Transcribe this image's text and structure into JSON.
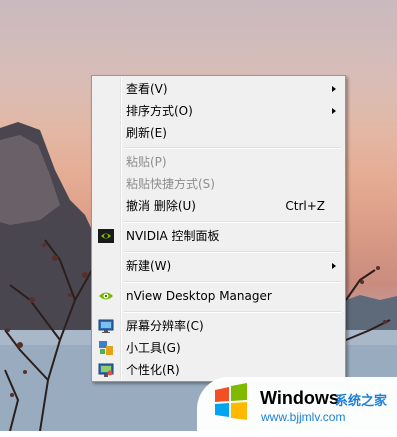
{
  "menu": {
    "items": [
      {
        "label": "查看(V)",
        "submenu": true
      },
      {
        "label": "排序方式(O)",
        "submenu": true
      },
      {
        "label": "刷新(E)"
      },
      {
        "label": "粘贴(P)",
        "disabled": true
      },
      {
        "label": "粘贴快捷方式(S)",
        "disabled": true
      },
      {
        "label": "撤消 删除(U)",
        "accelerator": "Ctrl+Z"
      },
      {
        "label": "NVIDIA 控制面板",
        "icon": "nvidia-icon"
      },
      {
        "label": "新建(W)",
        "submenu": true
      },
      {
        "label": "nView Desktop Manager",
        "icon": "nvidia-eye-icon"
      },
      {
        "label": "屏幕分辨率(C)",
        "icon": "monitor-resolution-icon"
      },
      {
        "label": "小工具(G)",
        "icon": "gadgets-icon"
      },
      {
        "label": "个性化(R)",
        "icon": "personalize-icon"
      }
    ]
  },
  "watermark": {
    "title": "Windows",
    "chinese": "系统之家",
    "url": "www.bjjmlv.com"
  },
  "colors": {
    "menu_bg": "#f0f0f0",
    "disabled_text": "#8d8d8d",
    "nvidia_green": "#76b900",
    "watermark_blue": "#1e7fd6"
  }
}
